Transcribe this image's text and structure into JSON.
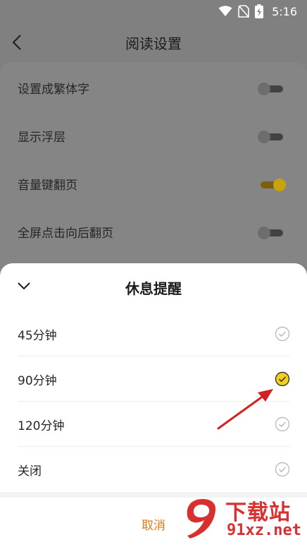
{
  "status_bar": {
    "time": "5:16"
  },
  "header": {
    "title": "阅读设置"
  },
  "settings": [
    {
      "label": "设置成繁体字",
      "enabled": false
    },
    {
      "label": "显示浮层",
      "enabled": false
    },
    {
      "label": "音量键翻页",
      "enabled": true
    },
    {
      "label": "全屏点击向后翻页",
      "enabled": false
    }
  ],
  "sheet": {
    "title": "休息提醒",
    "options": [
      {
        "label": "45分钟",
        "selected": false
      },
      {
        "label": "90分钟",
        "selected": true
      },
      {
        "label": "120分钟",
        "selected": false
      },
      {
        "label": "关闭",
        "selected": false
      }
    ],
    "cancel_label": "取消"
  },
  "watermark": {
    "title": "下载站",
    "site": "91xz.net"
  },
  "colors": {
    "accent": "#e07a14",
    "selected_check": "#f2d01c",
    "toggle_on": "#c9a20c",
    "annotation_arrow": "#d42020"
  }
}
